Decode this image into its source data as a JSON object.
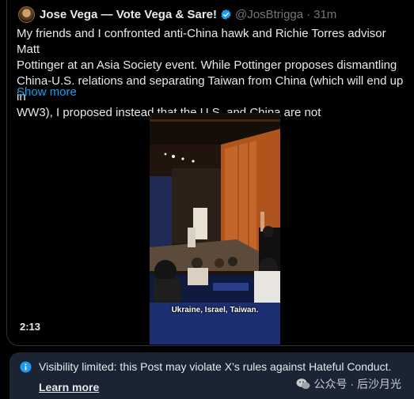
{
  "post": {
    "author": "Jose Vega — Vote Vega & Sare!",
    "handle": "@JosBtrigga",
    "separator": "·",
    "time": "31m",
    "text_lines": [
      "My friends and I confronted anti-China hawk and Richie Torres advisor Matt",
      "Pottinger at an Asia Society event. While Pottinger proposes dismantling",
      "China-U.S. relations and separating Taiwan from China (which will end up in",
      "WW3), I proposed instead that the U.S. and China are not"
    ],
    "show_more": "Show more"
  },
  "video": {
    "caption": "Ukraine, Israel, Taiwan.",
    "duration": "2:13"
  },
  "notice": {
    "text": "Visibility limited: this Post may violate X’s rules against Hateful Conduct.",
    "learn_more": "Learn more"
  },
  "watermark": {
    "text": "公众号 · 后沙月光"
  },
  "colors": {
    "background": "#000000",
    "text": "#e7e9ea",
    "muted": "#71767b",
    "link": "#1d9bf0",
    "notice_bg": "#1a2433"
  }
}
